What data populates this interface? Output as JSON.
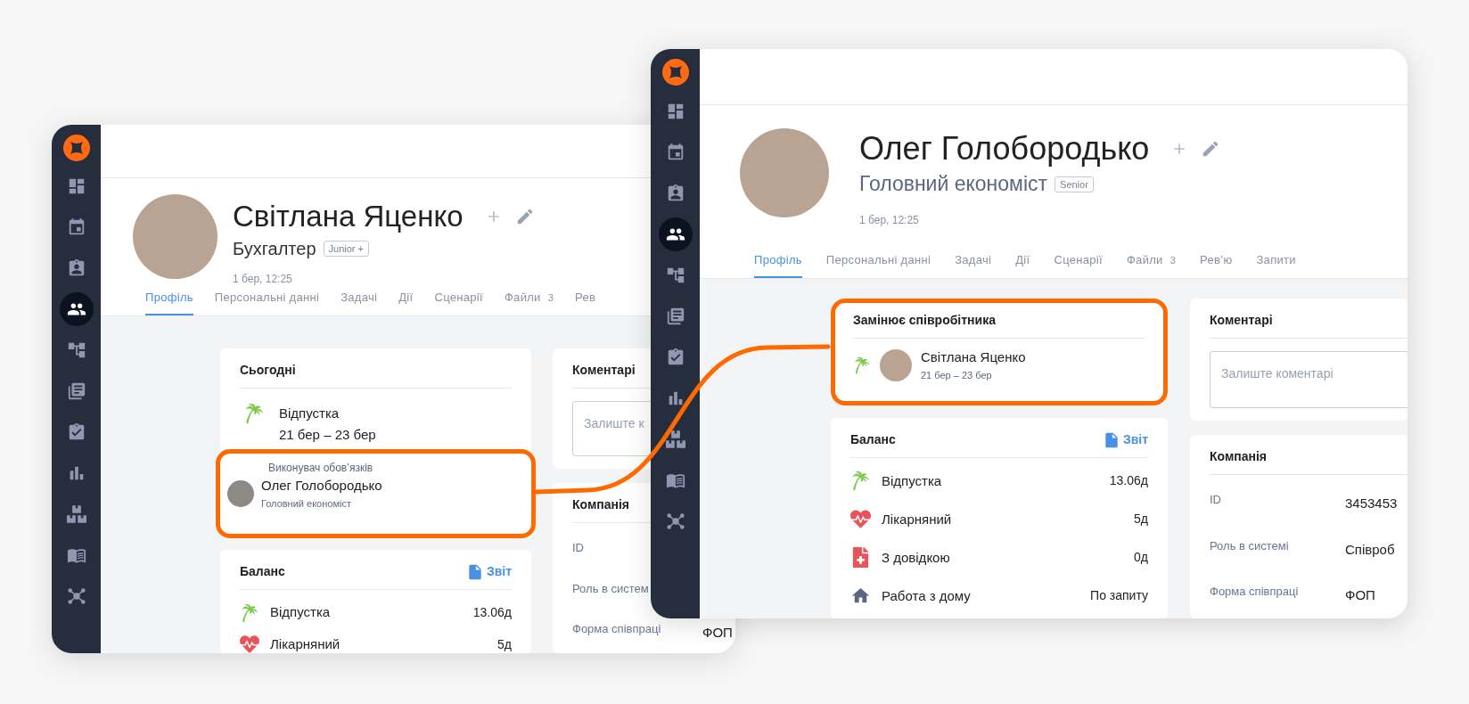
{
  "back_window": {
    "sidebar": [
      {
        "selected": false
      },
      {
        "selected": false
      },
      {
        "selected": false
      },
      {
        "selected": true
      },
      {
        "selected": false
      },
      {
        "selected": false
      },
      {
        "selected": false
      },
      {
        "selected": false
      },
      {
        "selected": false
      },
      {
        "selected": false
      },
      {
        "selected": false
      }
    ],
    "profile": {
      "name": "Світлана Яценко",
      "position": "Бухгалтер",
      "grade": "Junior +",
      "updated": "1 бер, 12:25"
    },
    "tabs": [
      {
        "label": "Профіль",
        "selected": true
      },
      {
        "label": "Персональні данні",
        "selected": false
      },
      {
        "label": "Задачі",
        "selected": false
      },
      {
        "label": "Дії",
        "selected": false
      },
      {
        "label": "Сценарії",
        "selected": false
      },
      {
        "label": "Файли",
        "count": "3",
        "selected": false
      },
      {
        "label": "Рев",
        "selected": false
      }
    ],
    "today_card": {
      "title": "Сьогодні",
      "absence": {
        "kind": "vacation",
        "type": "Відпустка",
        "dates": "21 бер – 23 бер"
      },
      "acting": {
        "highlighted": true,
        "label": "Виконувач обов’язків",
        "name": "Олег Голобородько",
        "position": "Головний економіст"
      }
    },
    "balance_card": {
      "title": "Баланс",
      "report": "Звіт",
      "rows": [
        {
          "kind": "vacation",
          "label": "Відпустка",
          "value": "13.06д"
        },
        {
          "kind": "sick",
          "label": "Лікарняний",
          "value": "5д"
        }
      ]
    },
    "comments_card": {
      "title": "Коментарі",
      "placeholder": "Залиште к"
    },
    "company_card": {
      "title": "Компанія",
      "rows": [
        {
          "label": "ID"
        },
        {
          "label": "Роль в систем"
        },
        {
          "label": "Форма співпраці",
          "value": "ФОП"
        }
      ]
    }
  },
  "front_window": {
    "sidebar": [
      {
        "selected": false
      },
      {
        "selected": false
      },
      {
        "selected": false
      },
      {
        "selected": true
      },
      {
        "selected": false
      },
      {
        "selected": false
      },
      {
        "selected": false
      },
      {
        "selected": false
      },
      {
        "selected": false
      },
      {
        "selected": false
      },
      {
        "selected": false
      }
    ],
    "profile": {
      "name": "Олег Голобородько",
      "position": "Головний економіст",
      "grade": "Senior",
      "updated": "1 бер, 12:25"
    },
    "tabs": [
      {
        "label": "Профіль",
        "selected": true
      },
      {
        "label": "Персональні данні",
        "selected": false
      },
      {
        "label": "Задачі",
        "selected": false
      },
      {
        "label": "Дії",
        "selected": false
      },
      {
        "label": "Сценарії",
        "selected": false
      },
      {
        "label": "Файли",
        "count": "3",
        "selected": false
      },
      {
        "label": "Рев’ю",
        "selected": false
      },
      {
        "label": "Запити",
        "selected": false
      }
    ],
    "replaces_card": {
      "highlighted": true,
      "title": "Замінює співробітника",
      "kind": "vacation",
      "name": "Світлана Яценко",
      "dates": "21 бер – 23 бер"
    },
    "balance_card": {
      "title": "Баланс",
      "report": "Звіт",
      "rows": [
        {
          "kind": "vacation",
          "label": "Відпустка",
          "value": "13.06д"
        },
        {
          "kind": "sick",
          "label": "Лікарняний",
          "value": "5д"
        },
        {
          "kind": "certificate",
          "label": "З довідкою",
          "value": "0д"
        },
        {
          "kind": "remote",
          "label": "Работа з дому",
          "value": "По запиту"
        }
      ]
    },
    "comments_card": {
      "title": "Коментарі",
      "placeholder": "Залиште коментарі"
    },
    "company_card": {
      "title": "Компанія",
      "rows": [
        {
          "label": "ID",
          "value": "3453453"
        },
        {
          "label": "Роль в системі",
          "value": "Співроб"
        },
        {
          "label": "Форма співпраці",
          "value": "ФОП"
        }
      ]
    }
  }
}
